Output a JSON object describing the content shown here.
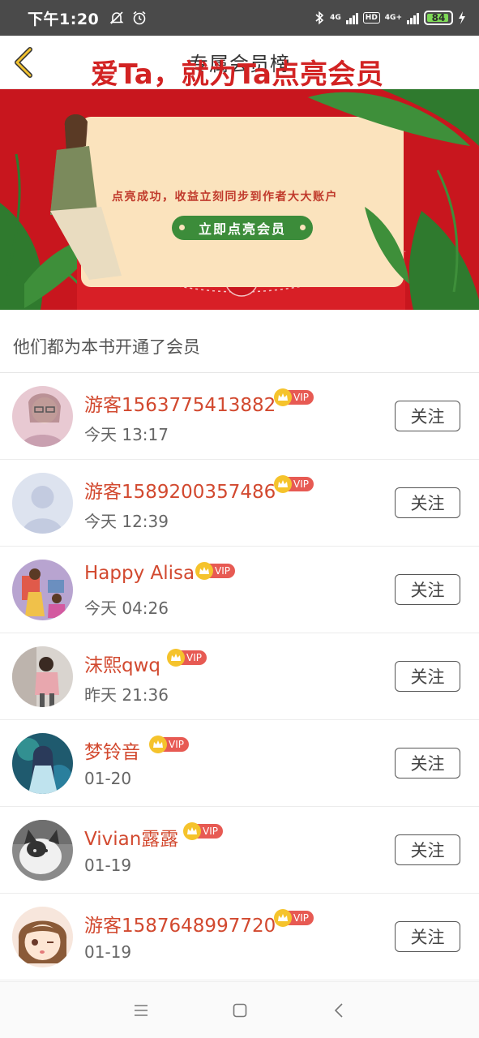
{
  "status_bar": {
    "time": "下午1:20",
    "network1": "4G",
    "network2": "4G+",
    "hd": "HD",
    "battery": "84"
  },
  "header": {
    "title": "专属会员榜"
  },
  "banner": {
    "title": "爱Ta，就为Ta点亮会员",
    "subtitle": "点亮成功，收益立刻同步到作者大大账户",
    "button": "立即点亮会员"
  },
  "section_label": "他们都为本书开通了会员",
  "vip_label": "VIP",
  "follow_label": "关注",
  "members": [
    {
      "name": "游客1563775413882",
      "time": "今天 13:17",
      "avatar": "girl-photo"
    },
    {
      "name": "游客1589200357486",
      "time": "今天 12:39",
      "avatar": "default-person"
    },
    {
      "name": "Happy Alisa",
      "time": "今天 04:26",
      "avatar": "illustration"
    },
    {
      "name": "沫熙qwq",
      "time": "昨天 21:36",
      "avatar": "person-photo"
    },
    {
      "name": "梦铃音",
      "time": "01-20",
      "avatar": "anime-girl"
    },
    {
      "name": "Vivian露露",
      "time": "01-19",
      "avatar": "cat-photo"
    },
    {
      "name": "游客1587648997720",
      "time": "01-19",
      "avatar": "anime-face"
    }
  ],
  "colors": {
    "accent": "#d2492f",
    "banner_red": "#c8161e",
    "vip_badge": "#e75a53",
    "crown": "#f5c32c"
  }
}
